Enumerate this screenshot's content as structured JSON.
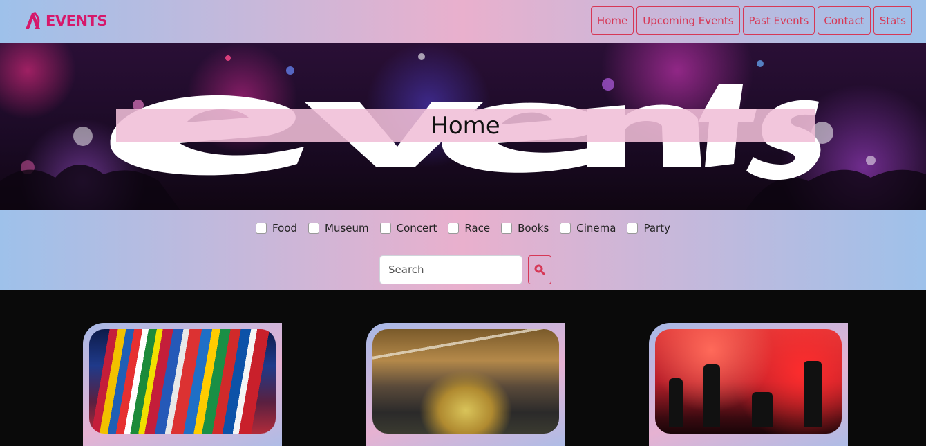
{
  "brand": {
    "logo_text": "EVENTS",
    "logo_icon": "a-logo-icon",
    "accent": "#d6186a"
  },
  "nav": {
    "items": [
      {
        "label": "Home"
      },
      {
        "label": "Upcoming Events"
      },
      {
        "label": "Past Events"
      },
      {
        "label": "Contact"
      },
      {
        "label": "Stats"
      }
    ],
    "accent": "#d63856"
  },
  "hero": {
    "title": "Home",
    "banner_word": "events"
  },
  "filters": {
    "categories": [
      {
        "label": "Food",
        "checked": false
      },
      {
        "label": "Museum",
        "checked": false
      },
      {
        "label": "Concert",
        "checked": false
      },
      {
        "label": "Race",
        "checked": false
      },
      {
        "label": "Books",
        "checked": false
      },
      {
        "label": "Cinema",
        "checked": false
      },
      {
        "label": "Party",
        "checked": false
      }
    ],
    "search": {
      "placeholder": "Search",
      "value": ""
    },
    "search_icon": "magnifier-icon"
  },
  "cards": [
    {
      "image": "flags-festival-photo"
    },
    {
      "image": "dinosaur-museum-photo"
    },
    {
      "image": "rock-concert-photo"
    }
  ]
}
